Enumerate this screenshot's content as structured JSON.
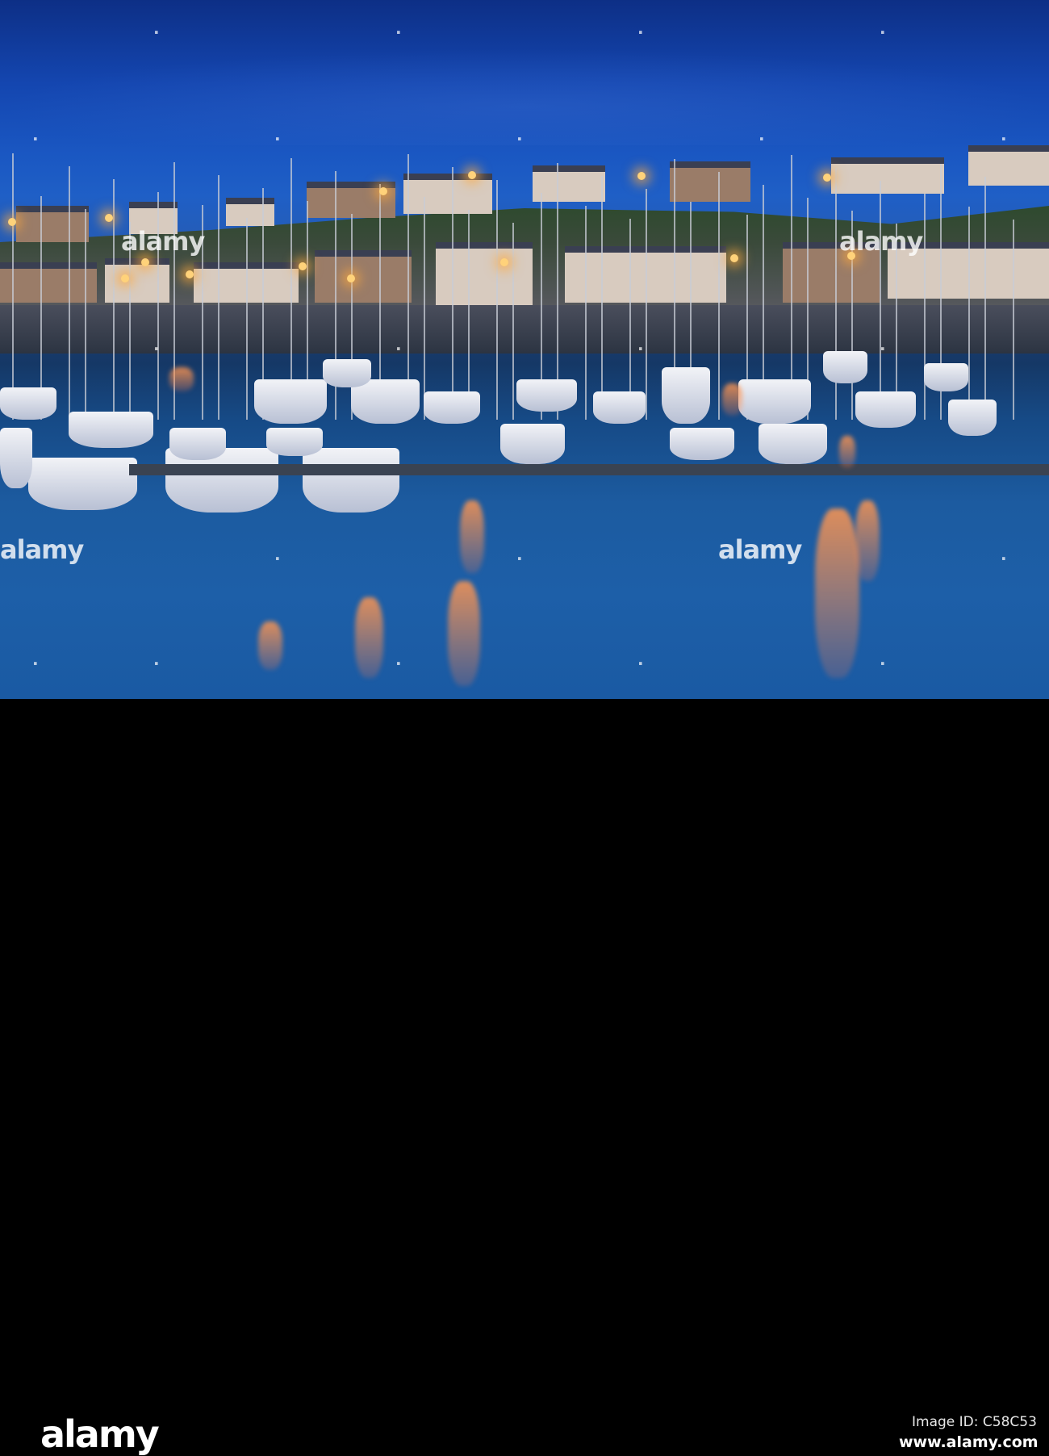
{
  "watermark": {
    "brand": "alamy"
  },
  "footer": {
    "logo": "alamy",
    "image_id": "Image ID: C58C53",
    "url": "www.alamy.com"
  },
  "colors": {
    "sky": "#1a57c2",
    "water": "#1d5fa8",
    "lights": "#ffb060"
  }
}
